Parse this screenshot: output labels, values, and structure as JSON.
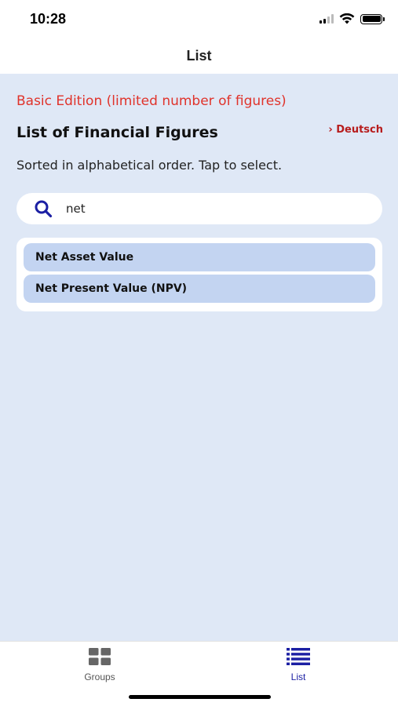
{
  "status_bar": {
    "time": "10:28"
  },
  "nav": {
    "title": "List"
  },
  "main": {
    "edition_note": "Basic Edition (limited number of figures)",
    "title": "List of Financial Figures",
    "language_link": "› Deutsch",
    "subtitle": "Sorted in alphabetical order. Tap to select.",
    "search": {
      "value": "net",
      "placeholder": ""
    },
    "results": [
      {
        "label": "Net Asset Value"
      },
      {
        "label": "Net Present Value (NPV)"
      }
    ]
  },
  "tab_bar": {
    "tabs": [
      {
        "label": "Groups",
        "icon": "grid-icon"
      },
      {
        "label": "List",
        "icon": "list-icon",
        "active": true
      }
    ]
  },
  "colors": {
    "background": "#dfe8f6",
    "accent": "#1b1fa3",
    "edition_red": "#e0332b",
    "item_fill": "#c3d4f1"
  }
}
